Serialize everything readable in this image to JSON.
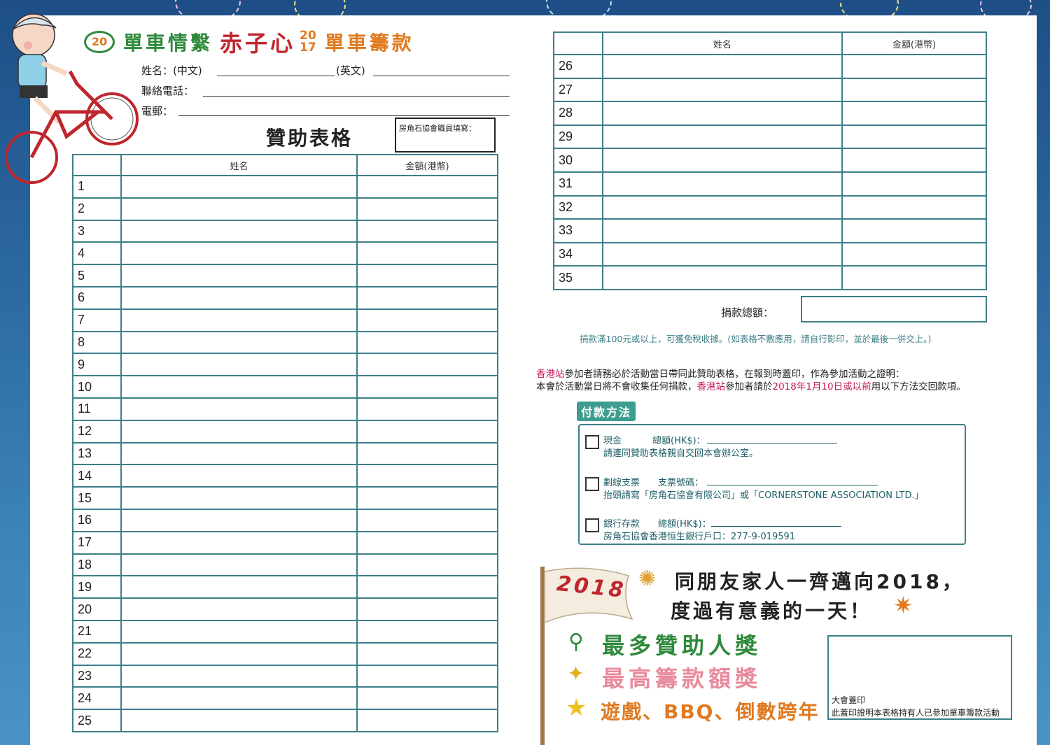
{
  "header": {
    "logo_year": "20",
    "title_part1": "單車情繫",
    "title_part2": "赤子心",
    "year_top": "20",
    "year_bottom": "17",
    "title_part3": "單車籌款"
  },
  "fields": {
    "name_label": "姓名：(中文)",
    "name_en_label": "(英文)",
    "phone_label": "聯絡電話：",
    "email_label": "電郵："
  },
  "form_title": "贊助表格",
  "staff_box_label": "房角石協會職員填寫：",
  "table": {
    "col_name": "姓名",
    "col_amount": "金額(港幣)"
  },
  "rows_left": [
    "1",
    "2",
    "3",
    "4",
    "5",
    "6",
    "7",
    "8",
    "9",
    "10",
    "11",
    "12",
    "13",
    "14",
    "15",
    "16",
    "17",
    "18",
    "19",
    "20",
    "21",
    "22",
    "23",
    "24",
    "25"
  ],
  "rows_right": [
    "26",
    "27",
    "28",
    "29",
    "30",
    "31",
    "32",
    "33",
    "34",
    "35"
  ],
  "total_label": "捐款總額：",
  "tax_note": "捐款滿100元或以上，可獲免稅收據。(如表格不敷應用，請自行影印，並於最後一併交上。)",
  "notice": {
    "line1_highlight": "香港站",
    "line1_rest": "參加者請務必於活動當日帶同此贊助表格，在報到時蓋印，作為參加活動之證明：",
    "line2_a": "本會於活動當日將不會收集任何捐款，",
    "line2_highlight": "香港站",
    "line2_b": "參加者請於",
    "line2_date": "2018年1月10日或以前",
    "line2_c": "用以下方法交回款項。"
  },
  "payment": {
    "title": "付款方法",
    "cash_label": "現金",
    "cash_total": "總額(HK$)：",
    "cash_note": "請連同贊助表格親自交回本會辦公室。",
    "cheque_label": "劃線支票",
    "cheque_no": "支票號碼：",
    "cheque_note": "抬頭請寫「房角石協會有限公司」或「CORNERSTONE ASSOCIATION LTD.」",
    "bank_label": "銀行存款",
    "bank_total": "總額(HK$)：",
    "bank_note": "房角石協會香港恒生銀行戶口：277-9-019591"
  },
  "promo": {
    "flag_year": "2018",
    "line1": "同朋友家人一齊邁向2018，",
    "line2": "度過有意義的一天！",
    "prize1": "最多贊助人獎",
    "prize2": "最高籌款額獎",
    "prize3": "遊戲、BBQ、倒數跨年"
  },
  "stamp": {
    "label": "大會蓋印",
    "note": "此蓋印證明本表格持有人已參加單車籌款活動"
  },
  "colors": {
    "teal": "#3d7f8a",
    "red": "#c0262d",
    "green": "#2f8a3c",
    "orange": "#e07a1f",
    "pink": "#c2185b",
    "sky": "#1d4f86"
  }
}
